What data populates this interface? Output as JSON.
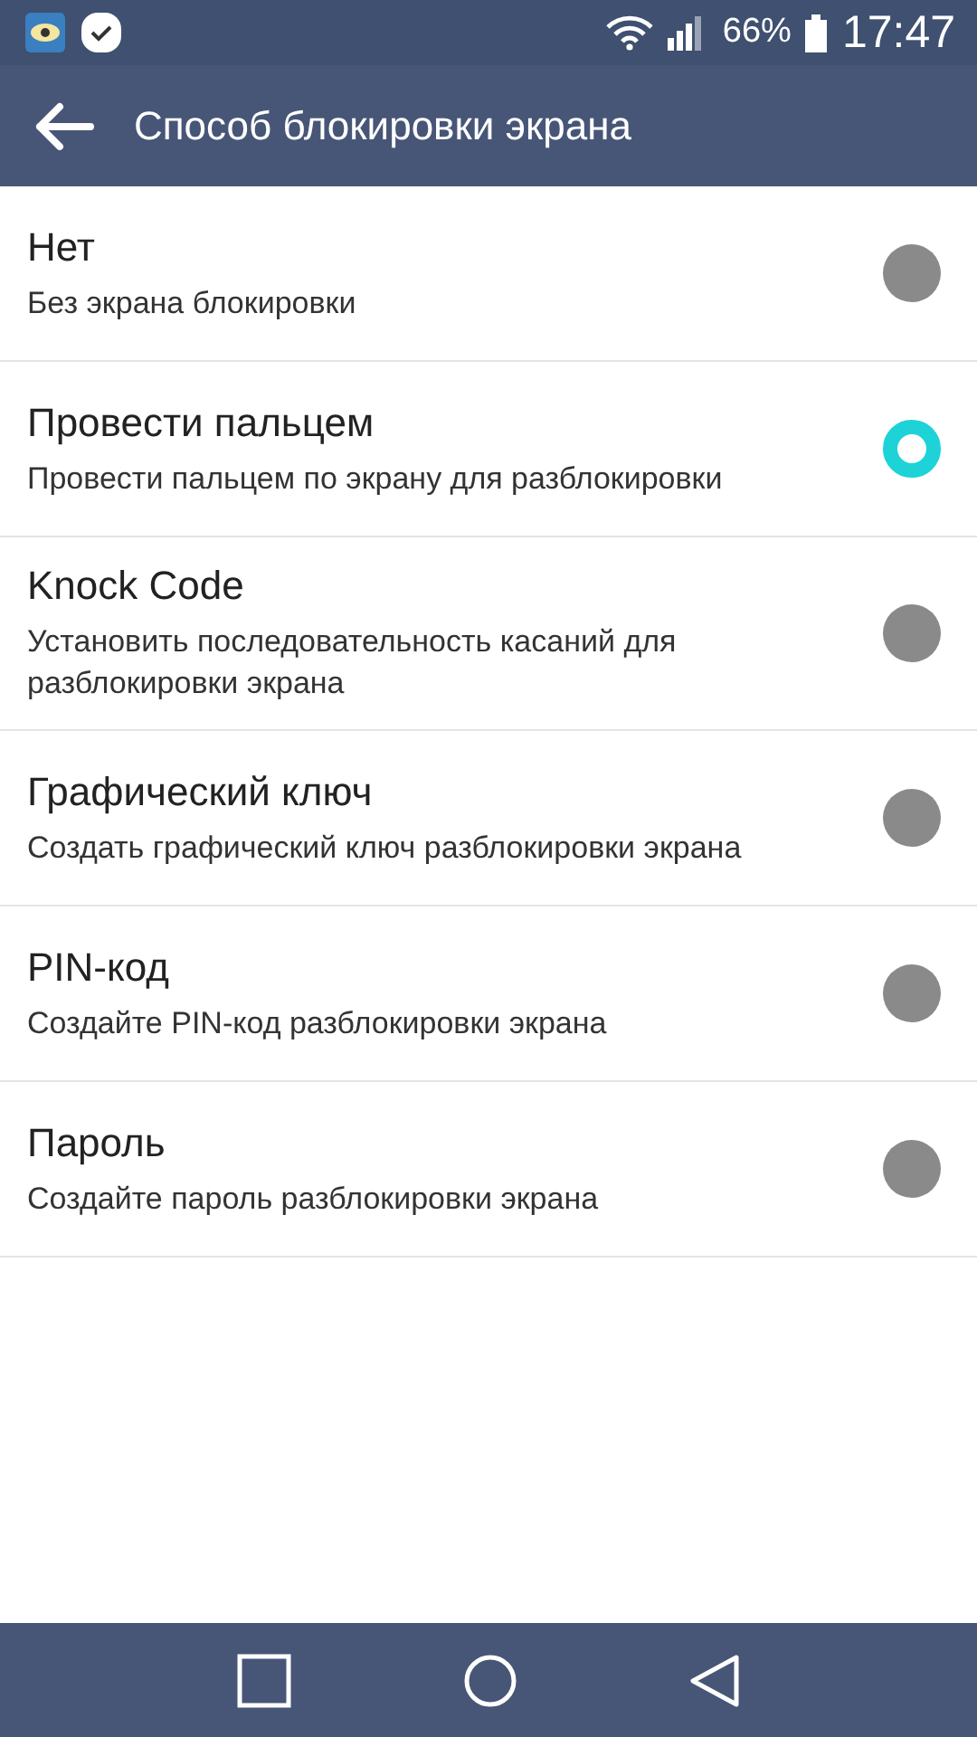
{
  "status_bar": {
    "battery": "66%",
    "time": "17:47"
  },
  "app_bar": {
    "title": "Способ блокировки экрана"
  },
  "options": [
    {
      "title": "Нет",
      "subtitle": "Без экрана блокировки",
      "selected": false
    },
    {
      "title": "Провести пальцем",
      "subtitle": "Провести пальцем по экрану для разблокировки",
      "selected": true
    },
    {
      "title": "Knock Code",
      "subtitle": "Установить последовательность касаний для разблокировки экрана",
      "selected": false
    },
    {
      "title": "Графический ключ",
      "subtitle": "Создать графический ключ разблокировки экрана",
      "selected": false
    },
    {
      "title": "PIN-код",
      "subtitle": "Создайте PIN-код разблокировки экрана",
      "selected": false
    },
    {
      "title": "Пароль",
      "subtitle": "Создайте пароль разблокировки экрана",
      "selected": false
    }
  ]
}
